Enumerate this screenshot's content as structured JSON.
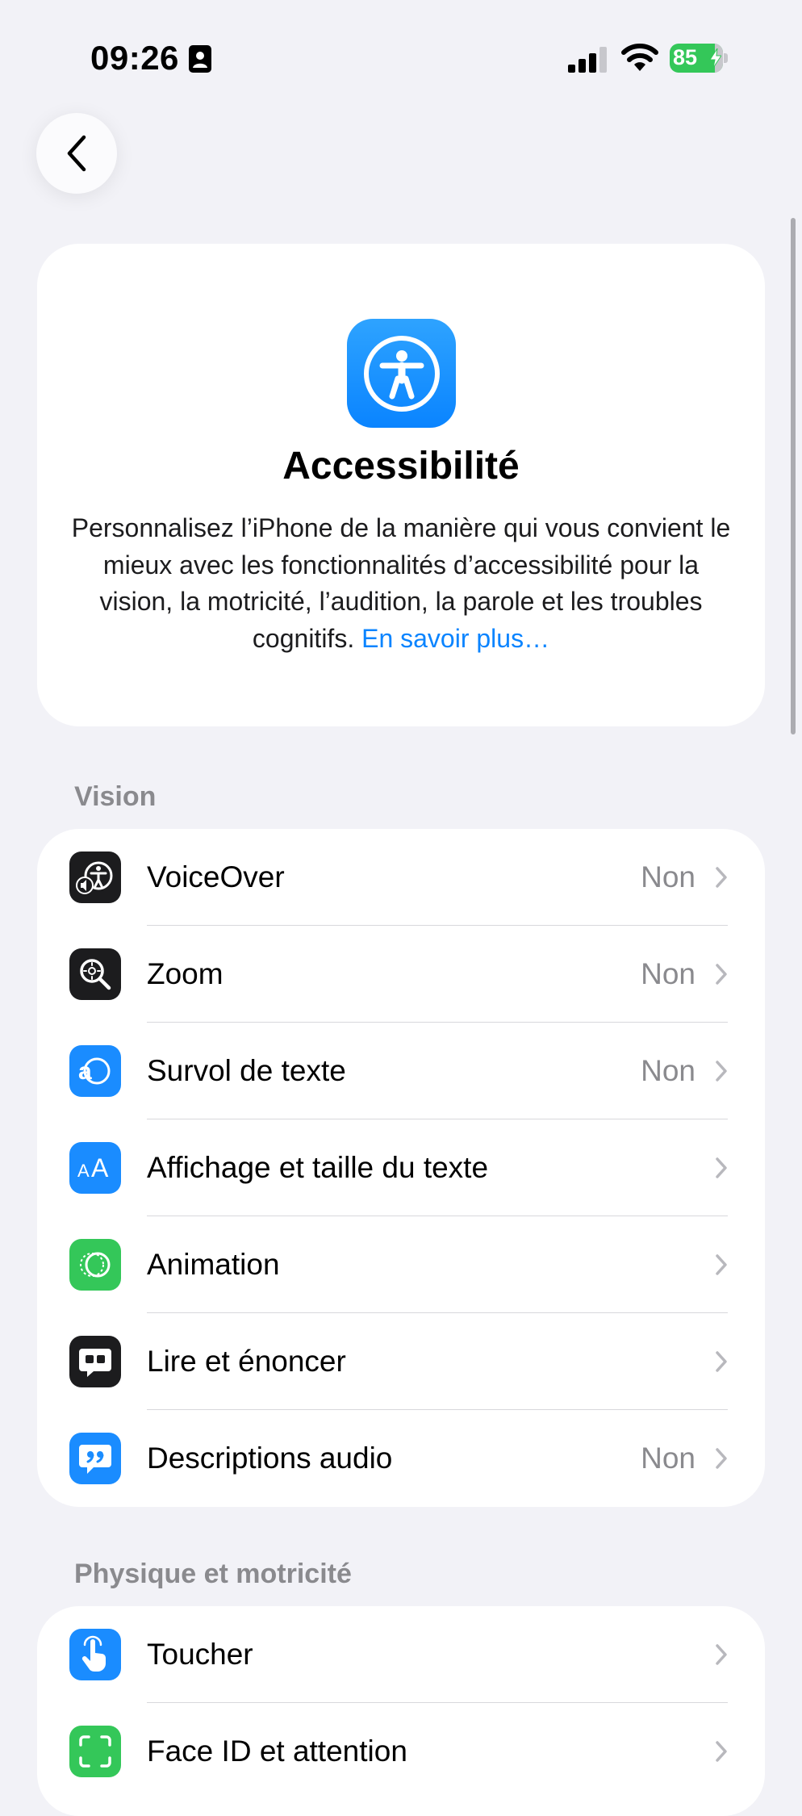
{
  "status_bar": {
    "time": "09:26",
    "battery_level": "85",
    "battery_charging": true
  },
  "hero": {
    "title": "Accessibilité",
    "description": "Personnalisez l’iPhone de la manière qui vous convient le mieux avec les fonctionnalités d’accessibilité pour la vision, la motricité, l’audition, la parole et les troubles cognitifs.",
    "link": "En savoir plus…",
    "icon": "accessibility-icon",
    "accent": "#0a84ff"
  },
  "sections": {
    "vision": {
      "header": "Vision",
      "items": [
        {
          "label": "VoiceOver",
          "value": "Non",
          "icon": "voiceover-icon",
          "color": "#1c1c1e"
        },
        {
          "label": "Zoom",
          "value": "Non",
          "icon": "zoom-icon",
          "color": "#1c1c1e"
        },
        {
          "label": "Survol de texte",
          "value": "Non",
          "icon": "hover-text-icon",
          "color": "#1a8cff"
        },
        {
          "label": "Affichage et taille du texte",
          "value": "",
          "icon": "text-size-icon",
          "color": "#1a8cff"
        },
        {
          "label": "Animation",
          "value": "",
          "icon": "motion-icon",
          "color": "#34c759"
        },
        {
          "label": "Lire et énoncer",
          "value": "",
          "icon": "spoken-content-icon",
          "color": "#1c1c1e"
        },
        {
          "label": "Descriptions audio",
          "value": "Non",
          "icon": "audio-descriptions-icon",
          "color": "#1a8cff"
        }
      ]
    },
    "physical": {
      "header": "Physique et motricité",
      "items": [
        {
          "label": "Toucher",
          "value": "",
          "icon": "touch-icon",
          "color": "#1a8cff"
        },
        {
          "label": "Face ID et attention",
          "value": "",
          "icon": "face-id-icon",
          "color": "#34c759"
        }
      ]
    }
  }
}
